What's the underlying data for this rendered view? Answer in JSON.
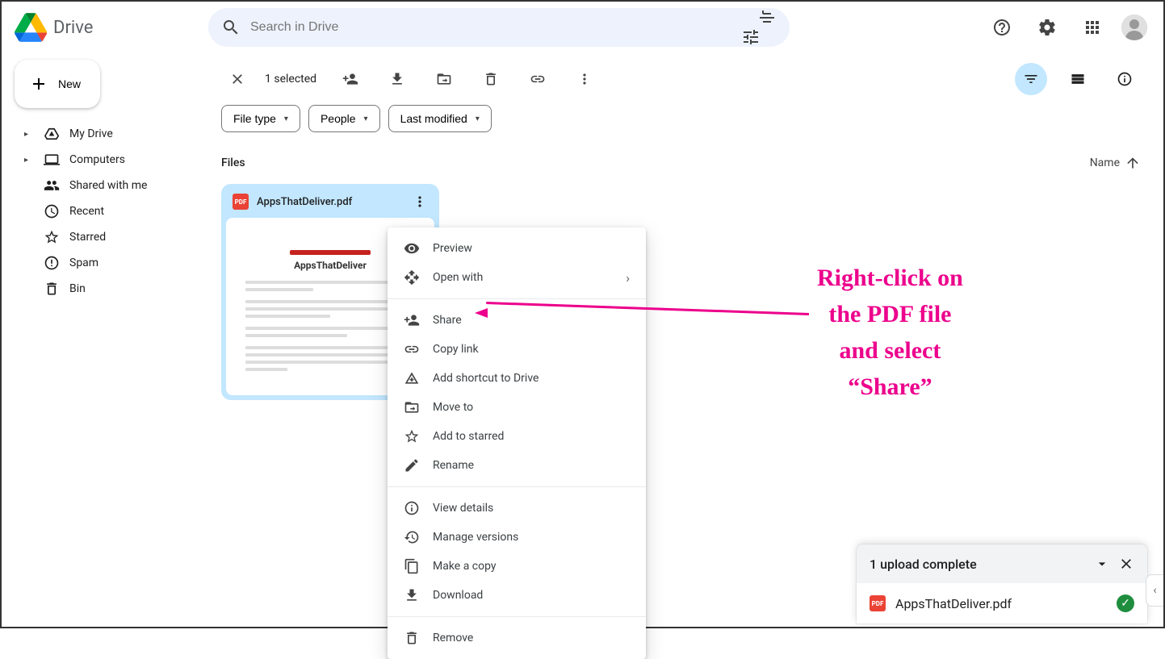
{
  "header": {
    "app_title": "Drive",
    "search_placeholder": "Search in Drive"
  },
  "sidebar": {
    "new_label": "New",
    "items": [
      {
        "label": "My Drive",
        "expandable": true
      },
      {
        "label": "Computers",
        "expandable": true
      },
      {
        "label": "Shared with me",
        "expandable": false
      },
      {
        "label": "Recent",
        "expandable": false
      },
      {
        "label": "Starred",
        "expandable": false
      },
      {
        "label": "Spam",
        "expandable": false
      },
      {
        "label": "Bin",
        "expandable": false
      }
    ]
  },
  "toolbar": {
    "selected_text": "1 selected"
  },
  "filters": {
    "file_type": "File type",
    "people": "People",
    "last_modified": "Last modified"
  },
  "section": {
    "files_label": "Files",
    "sort_label": "Name"
  },
  "file": {
    "name": "AppsThatDeliver.pdf",
    "preview_title": "AppsThatDeliver",
    "pdf_badge": "PDF"
  },
  "context_menu": {
    "preview": "Preview",
    "open_with": "Open with",
    "share": "Share",
    "copy_link": "Copy link",
    "add_shortcut": "Add shortcut to Drive",
    "move_to": "Move to",
    "add_starred": "Add to starred",
    "rename": "Rename",
    "view_details": "View details",
    "manage_versions": "Manage versions",
    "make_copy": "Make a copy",
    "download": "Download",
    "remove": "Remove"
  },
  "annotation": {
    "line1": "Right-click on",
    "line2": "the PDF file",
    "line3": "and select",
    "line4": "“Share”"
  },
  "upload": {
    "title": "1 upload complete",
    "file_name": "AppsThatDeliver.pdf"
  }
}
